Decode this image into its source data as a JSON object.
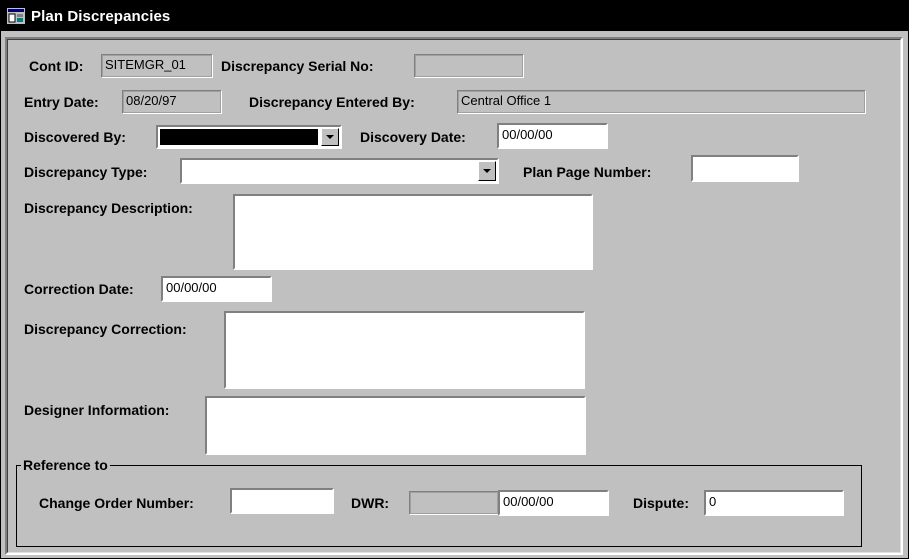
{
  "window": {
    "title": "Plan Discrepancies",
    "icon": "app-window-icon"
  },
  "form": {
    "cont_id": {
      "label": "Cont ID:",
      "value": "SITEMGR_01"
    },
    "discrepancy_serial_no": {
      "label": "Discrepancy Serial No:",
      "value": ""
    },
    "entry_date": {
      "label": "Entry Date:",
      "value": "08/20/97"
    },
    "discrepancy_entered_by": {
      "label": "Discrepancy Entered By:",
      "value": "Central Office 1"
    },
    "discovered_by": {
      "label": "Discovered By:",
      "value": ""
    },
    "discovery_date": {
      "label": "Discovery Date:",
      "value": "00/00/00"
    },
    "discrepancy_type": {
      "label": "Discrepancy Type:",
      "value": ""
    },
    "plan_page_number": {
      "label": "Plan Page Number:",
      "value": ""
    },
    "discrepancy_description": {
      "label": "Discrepancy Description:",
      "value": ""
    },
    "correction_date": {
      "label": "Correction Date:",
      "value": "00/00/00"
    },
    "discrepancy_correction": {
      "label": "Discrepancy Correction:",
      "value": ""
    },
    "designer_information": {
      "label": "Designer Information:",
      "value": ""
    }
  },
  "reference": {
    "group_label": "Reference to",
    "change_order_number": {
      "label": "Change Order Number:",
      "value": ""
    },
    "dwr": {
      "label": "DWR:",
      "value": "",
      "date_value": "00/00/00"
    },
    "dispute": {
      "label": "Dispute:",
      "value": "0"
    }
  }
}
